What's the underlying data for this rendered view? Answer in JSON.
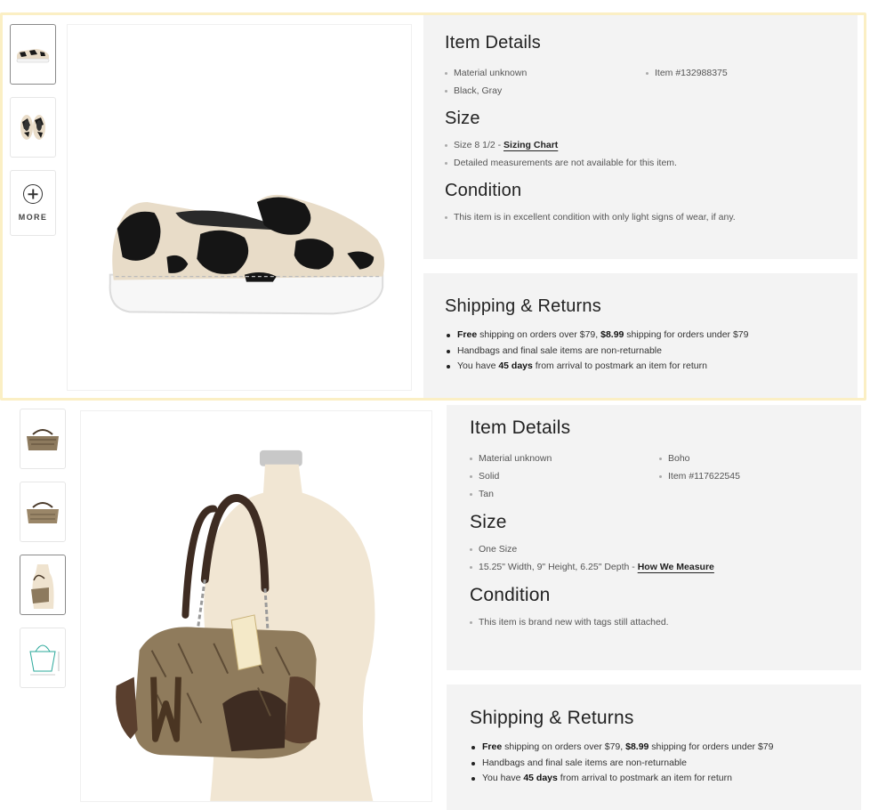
{
  "listings": [
    {
      "thumbnails": [
        "shoe-side-thumbnail",
        "shoe-pair-thumbnail"
      ],
      "more_label": "MORE",
      "item_details": {
        "heading": "Item Details",
        "left": [
          "Material unknown",
          "Black, Gray"
        ],
        "right": [
          "Item #132988375"
        ]
      },
      "size": {
        "heading": "Size",
        "size_text": "Size 8 1/2 - ",
        "size_link": "Sizing Chart",
        "note": "Detailed measurements are not available for this item."
      },
      "condition": {
        "heading": "Condition",
        "text": "This item is in excellent condition with only light signs of wear, if any."
      },
      "shipping": {
        "heading": "Shipping & Returns",
        "line1_bold": "Free",
        "line1_a": " shipping on orders over $79, ",
        "line1_price": "$8.99",
        "line1_b": " shipping for orders under $79",
        "line2": "Handbags and final sale items are non-returnable",
        "line3_a": "You have ",
        "line3_bold": "45 days",
        "line3_b": " from arrival to postmark an item for return"
      }
    },
    {
      "thumbnails": [
        "bag-front-thumbnail",
        "bag-back-thumbnail",
        "bag-on-mannequin-thumbnail",
        "bag-measurement-thumbnail"
      ],
      "item_details": {
        "heading": "Item Details",
        "left": [
          "Material unknown",
          "Solid",
          "Tan"
        ],
        "right": [
          "Boho",
          "Item #117622545"
        ]
      },
      "size": {
        "heading": "Size",
        "size_text": "One Size",
        "measure_text": "15.25\" Width, 9\" Height, 6.25\" Depth - ",
        "measure_link": "How We Measure"
      },
      "condition": {
        "heading": "Condition",
        "text": "This item is brand new with tags still attached."
      },
      "shipping": {
        "heading": "Shipping & Returns",
        "line1_bold": "Free",
        "line1_a": " shipping on orders over $79, ",
        "line1_price": "$8.99",
        "line1_b": " shipping for orders under $79",
        "line2": "Handbags and final sale items are non-returnable",
        "line3_a": "You have ",
        "line3_bold": "45 days",
        "line3_b": " from arrival to postmark an item for return"
      }
    }
  ]
}
